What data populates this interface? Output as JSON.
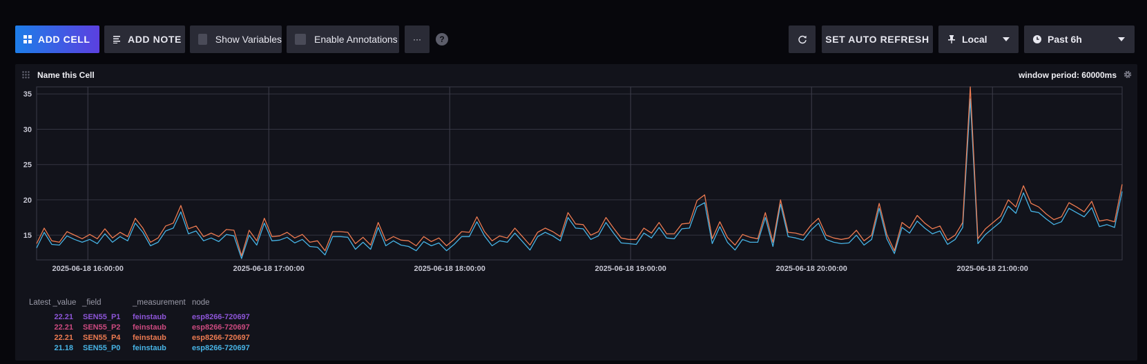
{
  "toolbar": {
    "add_cell": "ADD CELL",
    "add_note": "ADD NOTE",
    "show_variables": "Show Variables",
    "enable_annotations": "Enable Annotations",
    "more": "···",
    "help": "?",
    "auto_refresh": "SET AUTO REFRESH",
    "timezone": "Local",
    "time_range": "Past 6h"
  },
  "cell": {
    "title": "Name this Cell",
    "window_period": "window period: 60000ms"
  },
  "colors": {
    "background": "#07070c",
    "cell": "#12131b",
    "button": "#2a2b36",
    "series_p4": "#ee7b51",
    "series_p0": "#47b4e6",
    "series_p1": "#8d55d8",
    "series_p2": "#cd4a80"
  },
  "legend": {
    "headers": [
      "Latest _value",
      "_field",
      "_measurement",
      "node"
    ],
    "rows": [
      {
        "value": "22.21",
        "field": "SEN55_P1",
        "measurement": "feinstaub",
        "node": "esp8266-720697",
        "color": "#8d55d8"
      },
      {
        "value": "22.21",
        "field": "SEN55_P2",
        "measurement": "feinstaub",
        "node": "esp8266-720697",
        "color": "#cd4a80"
      },
      {
        "value": "22.21",
        "field": "SEN55_P4",
        "measurement": "feinstaub",
        "node": "esp8266-720697",
        "color": "#ee7b51"
      },
      {
        "value": "21.18",
        "field": "SEN55_P0",
        "measurement": "feinstaub",
        "node": "esp8266-720697",
        "color": "#47b4e6"
      }
    ]
  },
  "chart_data": {
    "type": "line",
    "ylim": [
      11.5,
      36
    ],
    "yticks": [
      15,
      20,
      25,
      30,
      35
    ],
    "x_start": "2025-06-18 15:43",
    "x_end": "2025-06-18 21:43",
    "xticks": [
      "2025-06-18 16:00:00",
      "2025-06-18 17:00:00",
      "2025-06-18 18:00:00",
      "2025-06-18 19:00:00",
      "2025-06-18 20:00:00",
      "2025-06-18 21:00:00"
    ],
    "grid": true,
    "series": [
      {
        "name": "SEN55_P4",
        "color": "#ee7b51",
        "values": [
          13.8,
          16.0,
          14.2,
          14.0,
          15.5,
          15.0,
          14.5,
          15.1,
          14.5,
          15.9,
          14.6,
          15.4,
          14.8,
          17.4,
          16.0,
          14.0,
          14.6,
          16.3,
          16.7,
          19.2,
          15.9,
          16.3,
          14.8,
          15.3,
          14.8,
          15.8,
          15.7,
          12.1,
          15.7,
          14.2,
          17.4,
          14.8,
          14.9,
          15.4,
          14.6,
          15.1,
          14.0,
          14.2,
          12.8,
          15.5,
          15.5,
          15.4,
          13.8,
          14.7,
          13.6,
          16.8,
          14.2,
          14.8,
          14.3,
          14.2,
          13.5,
          14.8,
          14.1,
          14.6,
          13.5,
          14.4,
          15.5,
          15.4,
          17.6,
          15.5,
          14.2,
          14.9,
          14.6,
          16.0,
          14.8,
          13.6,
          15.4,
          16.0,
          15.5,
          14.8,
          18.2,
          16.6,
          16.5,
          15.0,
          15.5,
          17.5,
          16.0,
          14.6,
          14.4,
          14.4,
          16.0,
          15.3,
          16.8,
          15.2,
          15.2,
          16.6,
          16.7,
          19.9,
          20.7,
          14.5,
          16.9,
          14.7,
          13.6,
          15.1,
          14.7,
          14.5,
          18.2,
          14.0,
          20.0,
          15.4,
          15.3,
          15.0,
          16.4,
          17.4,
          15.0,
          14.6,
          14.4,
          14.6,
          15.7,
          14.2,
          15.0,
          19.5,
          15.1,
          12.8,
          16.8,
          16.0,
          17.8,
          16.7,
          15.9,
          16.3,
          14.3,
          15.0,
          16.8,
          36.0,
          14.5,
          15.9,
          16.8,
          17.7,
          20.0,
          19.0,
          22.0,
          19.5,
          19.0,
          18.0,
          17.2,
          17.6,
          19.6,
          19.0,
          18.3,
          19.8,
          17.0,
          17.2,
          16.9,
          22.2
        ]
      },
      {
        "name": "SEN55_P0",
        "color": "#47b4e6",
        "values": [
          13.2,
          15.4,
          13.7,
          13.6,
          14.9,
          14.4,
          14.0,
          14.4,
          13.8,
          15.2,
          14.0,
          14.8,
          14.2,
          16.7,
          15.4,
          13.5,
          14.0,
          15.6,
          16.0,
          18.3,
          15.2,
          15.6,
          14.2,
          14.6,
          14.1,
          15.1,
          14.9,
          11.7,
          15.0,
          13.6,
          16.7,
          14.2,
          14.3,
          14.7,
          13.9,
          14.4,
          13.4,
          13.3,
          12.2,
          14.8,
          14.8,
          14.7,
          13.0,
          14.0,
          13.0,
          16.1,
          13.5,
          14.2,
          13.6,
          13.4,
          12.8,
          14.1,
          13.5,
          13.9,
          12.8,
          13.7,
          14.8,
          14.8,
          16.9,
          14.9,
          13.5,
          14.2,
          14.0,
          15.3,
          14.1,
          12.9,
          14.8,
          15.4,
          14.9,
          14.2,
          17.5,
          16.0,
          15.9,
          14.4,
          14.9,
          16.8,
          15.3,
          13.9,
          13.8,
          13.7,
          15.3,
          14.6,
          16.1,
          14.6,
          14.5,
          15.9,
          16.0,
          19.0,
          19.6,
          13.8,
          16.2,
          14.0,
          12.9,
          14.4,
          14.0,
          14.0,
          17.5,
          13.4,
          19.4,
          14.8,
          14.6,
          14.3,
          15.7,
          16.7,
          14.4,
          14.0,
          13.8,
          13.9,
          15.0,
          13.6,
          14.4,
          18.8,
          14.5,
          12.4,
          16.1,
          15.3,
          17.0,
          16.0,
          15.2,
          15.6,
          13.7,
          14.4,
          16.1,
          34.3,
          13.8,
          15.1,
          16.0,
          16.9,
          19.1,
          18.1,
          21.0,
          18.4,
          18.2,
          17.3,
          16.5,
          16.9,
          18.8,
          18.2,
          17.6,
          18.9,
          16.2,
          16.5,
          16.1,
          21.2
        ]
      }
    ]
  }
}
